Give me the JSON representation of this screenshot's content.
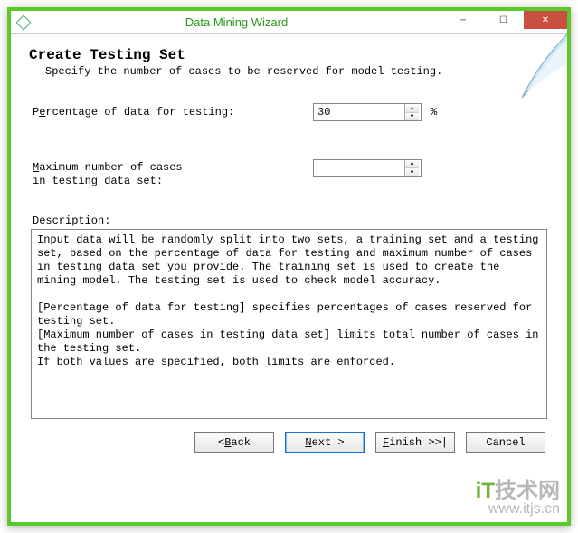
{
  "window": {
    "title": "Data Mining Wizard"
  },
  "header": {
    "title": "Create Testing Set",
    "subtitle": "Specify the number of cases to be reserved for model testing."
  },
  "fields": {
    "percentage": {
      "label_pre": "P",
      "label_ul": "e",
      "label_post": "rcentage of data for testing:",
      "value": "30",
      "unit": "%"
    },
    "maxcases": {
      "label_pre": "",
      "label_ul": "M",
      "label_post": "aximum number of cases\nin testing data set:",
      "value": ""
    }
  },
  "description": {
    "label": "Description:",
    "text": "Input data will be randomly split into two sets, a training set and a testing set, based on the percentage of data for testing and maximum number of cases in testing data set you provide. The training set is used to create the mining model. The testing set is used to check model accuracy.\n\n[Percentage of data for testing] specifies percentages of cases reserved for testing set.\n[Maximum number of cases in testing data set] limits total number of cases in the testing set.\nIf both values are specified, both limits are enforced."
  },
  "buttons": {
    "back_pre": "< ",
    "back_ul": "B",
    "back_post": "ack",
    "next_pre": "",
    "next_ul": "N",
    "next_post": "ext >",
    "finish_pre": "",
    "finish_ul": "F",
    "finish_post": "inish >>|",
    "cancel": "Cancel"
  },
  "watermark": {
    "brand_text": "技术网",
    "url": "www.itjs.cn"
  }
}
